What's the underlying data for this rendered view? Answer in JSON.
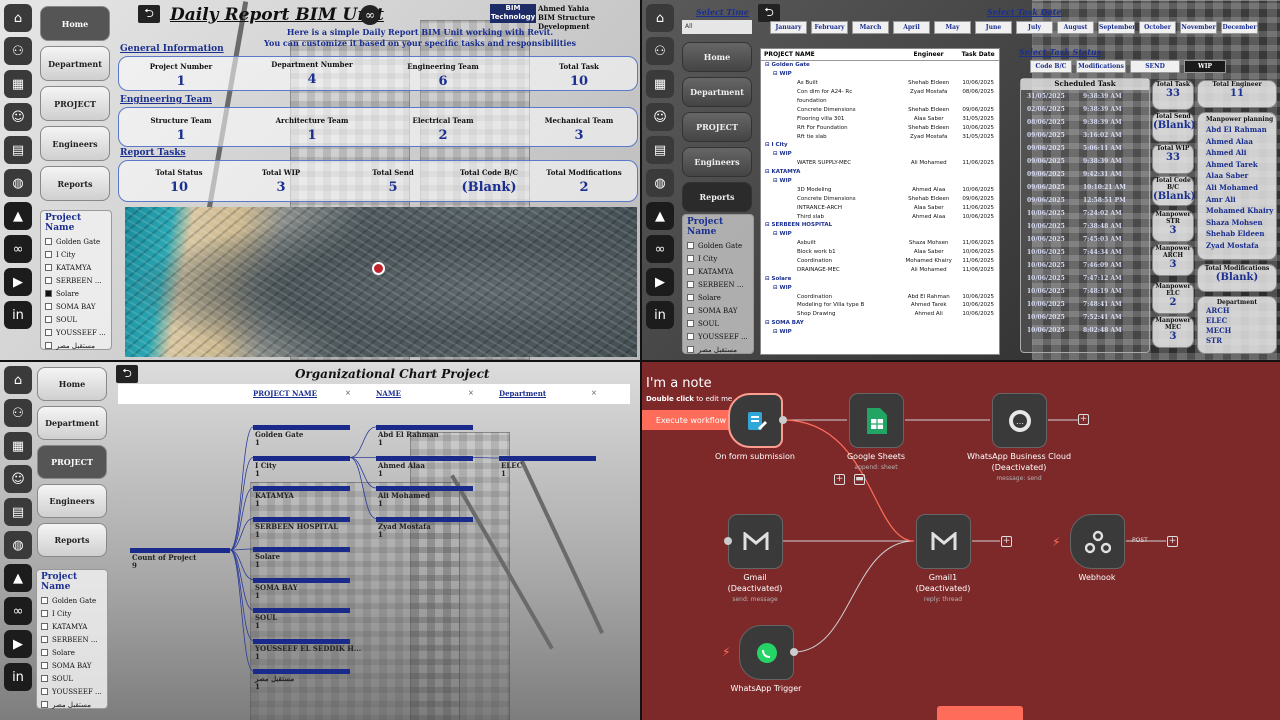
{
  "nav": {
    "home": "Home",
    "department": "Department",
    "project": "PROJECT",
    "engineers": "Engineers",
    "reports": "Reports"
  },
  "slicer": {
    "title": "Project Name",
    "items": [
      "Golden Gate",
      "I City",
      "KATAMYA",
      "SERBEEN ...",
      "Solare",
      "SOMA BAY",
      "SOUL",
      "YOUSSEEF ...",
      "مستقبل مصر"
    ]
  },
  "q1": {
    "title": "Daily Report BIM Unit",
    "logo": "BIM Technology",
    "author": "Ahmed Yahia",
    "author_role": "BIM Structure Development",
    "intro1": "Here is a simple Daily Report BIM Unit working with Revit.",
    "intro2": "You can customize it based on your specific tasks and responsibilities",
    "general": "General Information",
    "general_kpis": [
      {
        "l": "Project Number",
        "v": "1"
      },
      {
        "l": "Department Number",
        "v": "4"
      },
      {
        "l": "Engineering Team",
        "v": "6"
      },
      {
        "l": "Total Task",
        "v": "10"
      }
    ],
    "eng_team": "Engineering Team",
    "eng_kpis": [
      {
        "l": "Structure Team",
        "v": "1"
      },
      {
        "l": "Architecture Team",
        "v": "1"
      },
      {
        "l": "Electrical Team",
        "v": "2"
      },
      {
        "l": "Mechanical Team",
        "v": "3"
      }
    ],
    "report_tasks": "Report Tasks",
    "report_kpis": [
      {
        "l": "Total Status",
        "v": "10"
      },
      {
        "l": "Total WIP",
        "v": "3"
      },
      {
        "l": "Total Send",
        "v": "5"
      },
      {
        "l": "Total Code B/C",
        "v": "(Blank)"
      },
      {
        "l": "Total Modifications",
        "v": "2"
      }
    ]
  },
  "q2": {
    "select_time": "Select Time",
    "time_value": "All",
    "select_date": "Select Task Date",
    "months": [
      "January",
      "February",
      "March",
      "April",
      "May",
      "June",
      "July",
      "August",
      "September",
      "October",
      "November",
      "December"
    ],
    "select_status": "Select Task Status",
    "statuses": [
      "Code B/C",
      "Modifications",
      "SEND",
      "WIP"
    ],
    "headers": [
      "PROJECT NAME",
      "Engineer",
      "Task Date"
    ],
    "rows": [
      [
        "⊟ Golden Gate",
        "",
        "",
        "g"
      ],
      [
        "⊟ WIP",
        "",
        "",
        "g"
      ],
      [
        "As Built",
        "Shehab Eldeen",
        "10/06/2025",
        ""
      ],
      [
        "Con dim for A24- Rc",
        "Zyad Mostafa",
        "08/06/2025",
        ""
      ],
      [
        "foundation",
        "",
        "",
        ""
      ],
      [
        "Concrete Dimensions",
        "Shehab Eldeen",
        "09/06/2025",
        ""
      ],
      [
        "Flooring villa 301",
        "Alaa Saber",
        "31/05/2025",
        ""
      ],
      [
        "Rft For Foundation",
        "Shehab Eldeen",
        "10/06/2025",
        ""
      ],
      [
        "Rft tie slab",
        "Zyad Mostafa",
        "31/05/2025",
        ""
      ],
      [
        "⊟ I City",
        "",
        "",
        "g"
      ],
      [
        "⊟ WIP",
        "",
        "",
        "g"
      ],
      [
        "WATER SUPPLY-MEC",
        "Ali Mohamed",
        "11/06/2025",
        ""
      ],
      [
        "⊟ KATAMYA",
        "",
        "",
        "g"
      ],
      [
        "⊟ WIP",
        "",
        "",
        "g"
      ],
      [
        "3D Modeling",
        "Ahmed Alaa",
        "10/06/2025",
        ""
      ],
      [
        "Concrete Dimensions",
        "Shehab Eldeen",
        "09/06/2025",
        ""
      ],
      [
        "INTRANCE-ARCH",
        "Alaa Saber",
        "11/06/2025",
        ""
      ],
      [
        "Third slab",
        "Ahmed Alaa",
        "10/06/2025",
        ""
      ],
      [
        "⊟ SERBEEN HOSPITAL",
        "",
        "",
        "g"
      ],
      [
        "⊟ WIP",
        "",
        "",
        "g"
      ],
      [
        "Asbuilt",
        "Shaza Mohsen",
        "11/06/2025",
        ""
      ],
      [
        "Block work b1",
        "Alaa Saber",
        "10/06/2025",
        ""
      ],
      [
        "Coordination",
        "Mohamed Khairy",
        "11/06/2025",
        ""
      ],
      [
        "DRAINAGE-MEC",
        "Ali Mohamed",
        "11/06/2025",
        ""
      ],
      [
        "⊟ Solare",
        "",
        "",
        "g"
      ],
      [
        "⊟ WIP",
        "",
        "",
        "g"
      ],
      [
        "Coordination",
        "Abd El Rahman",
        "10/06/2025",
        ""
      ],
      [
        "Modeling for Villa type B",
        "Ahmed Tarek",
        "10/06/2025",
        ""
      ],
      [
        "Shop Drawing",
        "Ahmed Ali",
        "10/06/2025",
        ""
      ],
      [
        "⊟ SOMA BAY",
        "",
        "",
        "g"
      ],
      [
        "⊟ WIP",
        "",
        "",
        "g"
      ]
    ],
    "sched_title": "Scheduled Task",
    "sched": [
      [
        "31/05/2025",
        "9:38:39 AM"
      ],
      [
        "02/06/2025",
        "9:38:39 AM"
      ],
      [
        "08/06/2025",
        "9:38:39 AM"
      ],
      [
        "09/06/2025",
        "3:16:02 AM"
      ],
      [
        "09/06/2025",
        "5:06:11 AM"
      ],
      [
        "09/06/2025",
        "9:38:39 AM"
      ],
      [
        "09/06/2025",
        "9:42:31 AM"
      ],
      [
        "09/06/2025",
        "10:10:21 AM"
      ],
      [
        "09/06/2025",
        "12:58:51 PM"
      ],
      [
        "10/06/2025",
        "7:24:02 AM"
      ],
      [
        "10/06/2025",
        "7:38:48 AM"
      ],
      [
        "10/06/2025",
        "7:45:03 AM"
      ],
      [
        "10/06/2025",
        "7:44:34 AM"
      ],
      [
        "10/06/2025",
        "7:46:09 AM"
      ],
      [
        "10/06/2025",
        "7:47:12 AM"
      ],
      [
        "10/06/2025",
        "7:48:19 AM"
      ],
      [
        "10/06/2025",
        "7:48:41 AM"
      ],
      [
        "10/06/2025",
        "7:52:41 AM"
      ],
      [
        "10/06/2025",
        "8:02:48 AM"
      ]
    ],
    "kpis": [
      {
        "l": "Total Task",
        "v": "33"
      },
      {
        "l": "Total Send",
        "v": "(Blank)"
      },
      {
        "l": "Total WIP",
        "v": "33"
      },
      {
        "l": "Total Code B/C",
        "v": "(Blank)"
      },
      {
        "l": "Manpower STR",
        "v": "3"
      },
      {
        "l": "Manpower ARCH",
        "v": "3"
      },
      {
        "l": "Manpower ELC",
        "v": "2"
      },
      {
        "l": "Manpower MEC",
        "v": "3"
      }
    ],
    "total_engineer": {
      "l": "Total Engineer",
      "v": "11"
    },
    "manpower_title": "Manpower planning",
    "engineers": [
      "Abd El Rahman",
      "Ahmed Alaa",
      "Ahmed Ali",
      "Ahmed Tarek",
      "Alaa Saber",
      "Ali Mohamed",
      "Amr Ali",
      "Mohamed Khairy",
      "Shaza Mohsen",
      "Shehab Eldeen",
      "Zyad Mostafa"
    ],
    "total_mod": {
      "l": "Total Modifications",
      "v": "(Blank)"
    },
    "dept_title": "Department",
    "depts": [
      "ARCH",
      "ELEC",
      "MECH",
      "STR"
    ]
  },
  "q3": {
    "title": "Organizational Chart Project",
    "filters": [
      "PROJECT NAME",
      "NAME",
      "Department"
    ],
    "root": {
      "l": "Count of Project",
      "v": "9"
    },
    "projects": [
      {
        "l": "Golden Gate",
        "v": "1"
      },
      {
        "l": "I City",
        "v": "1"
      },
      {
        "l": "KATAMYA",
        "v": "1"
      },
      {
        "l": "SERBEEN HOSPITAL",
        "v": "1"
      },
      {
        "l": "Solare",
        "v": "1"
      },
      {
        "l": "SOMA BAY",
        "v": "1"
      },
      {
        "l": "SOUL",
        "v": "1"
      },
      {
        "l": "YOUSSEEF EL SEDDIK H...",
        "v": "1"
      },
      {
        "l": "مستقبل مصر",
        "v": "1"
      }
    ],
    "names": [
      {
        "l": "Abd El Rahman",
        "v": "1"
      },
      {
        "l": "Ahmed Alaa",
        "v": "1"
      },
      {
        "l": "Ali Mohamed",
        "v": "1"
      },
      {
        "l": "Zyad Mostafa",
        "v": "1"
      }
    ],
    "dept": {
      "l": "ELEC",
      "v": "1"
    }
  },
  "q4": {
    "note_title": "I'm a note",
    "note_sub": "Double click",
    "note_sub2": "to edit me",
    "execute": "Execute workflow",
    "nodes": {
      "form": {
        "l": "On form submission",
        "s": ""
      },
      "sheets": {
        "l": "Google Sheets",
        "s": "append: sheet"
      },
      "wa_cloud": {
        "l": "WhatsApp Business Cloud",
        "l2": "(Deactivated)",
        "s": "message: send"
      },
      "gmail": {
        "l": "Gmail",
        "l2": "(Deactivated)",
        "s": "send: message"
      },
      "gmail1": {
        "l": "Gmail1",
        "l2": "(Deactivated)",
        "s": "reply: thread"
      },
      "webhook": {
        "l": "Webhook",
        "s": ""
      },
      "wa_trig": {
        "l": "WhatsApp Trigger",
        "s": ""
      }
    },
    "post": "POST",
    "colors": {
      "bg": "#7e2929",
      "node": "#3a3a3a",
      "accent": "#ff6d5a",
      "sheets": "#21a464",
      "wa": "#25d366"
    }
  }
}
